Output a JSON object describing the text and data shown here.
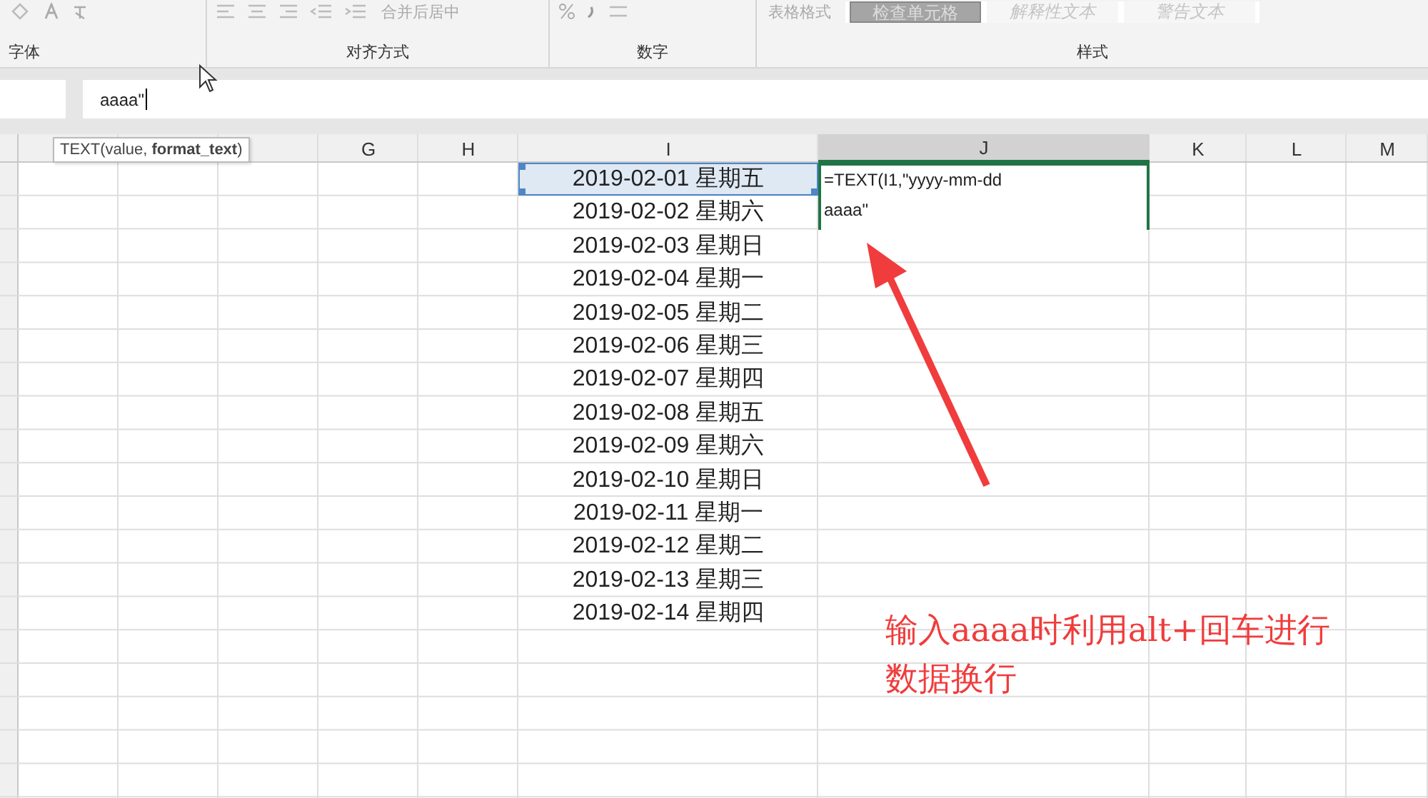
{
  "ribbon": {
    "groups": [
      {
        "label": "字体"
      },
      {
        "label": "对齐方式",
        "merge_button": "合并后居中"
      },
      {
        "label": "数字"
      },
      {
        "label": "样式",
        "table_format": "表格格式",
        "cell_styles": [
          {
            "label": "检查单元格",
            "kind": "dark"
          },
          {
            "label": "解释性文本",
            "kind": "light"
          },
          {
            "label": "警告文本",
            "kind": "light"
          }
        ]
      }
    ]
  },
  "formula_bar": {
    "value": "aaaa\""
  },
  "tooltip": {
    "text": "TEXT(value, **format_text**)"
  },
  "columns": [
    {
      "label": "G",
      "selected": false
    },
    {
      "label": "H",
      "selected": false
    },
    {
      "label": "I",
      "selected": false
    },
    {
      "label": "J",
      "selected": true
    },
    {
      "label": "K",
      "selected": false
    },
    {
      "label": "L",
      "selected": false
    },
    {
      "label": "M",
      "selected": false
    }
  ],
  "column_i": [
    {
      "value": "2019-02-01 星期五",
      "referenced": true
    },
    {
      "value": "2019-02-02 星期六",
      "referenced": false
    },
    {
      "value": "2019-02-03 星期日",
      "referenced": false
    },
    {
      "value": "2019-02-04 星期一",
      "referenced": false
    },
    {
      "value": "2019-02-05 星期二",
      "referenced": false
    },
    {
      "value": "2019-02-06 星期三",
      "referenced": false
    },
    {
      "value": "2019-02-07 星期四",
      "referenced": false
    },
    {
      "value": "2019-02-08 星期五",
      "referenced": false
    },
    {
      "value": "2019-02-09 星期六",
      "referenced": false
    },
    {
      "value": "2019-02-10 星期日",
      "referenced": false
    },
    {
      "value": "2019-02-11 星期一",
      "referenced": false
    },
    {
      "value": "2019-02-12 星期二",
      "referenced": false
    },
    {
      "value": "2019-02-13 星期三",
      "referenced": false
    },
    {
      "value": "2019-02-14 星期四",
      "referenced": false
    }
  ],
  "active_cell": {
    "lines": [
      "=TEXT(I1,\"yyyy-mm-dd",
      "aaaa\""
    ]
  },
  "annotation": {
    "lines": [
      "输入aaaa时利用alt+回车进行",
      "数据换行"
    ]
  }
}
